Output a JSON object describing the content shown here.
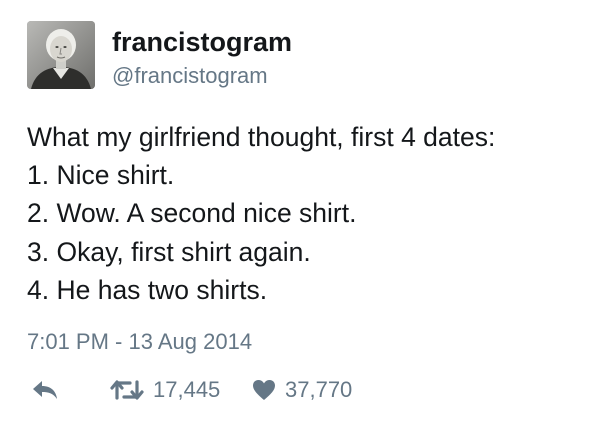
{
  "tweet": {
    "display_name": "francistogram",
    "handle": "@francistogram",
    "lines": [
      "What my girlfriend thought, first 4 dates:",
      "1. Nice shirt.",
      "2. Wow. A second nice shirt.",
      "3. Okay, first shirt again.",
      "4. He has two shirts."
    ],
    "timestamp": "7:01 PM - 13 Aug 2014"
  },
  "actions": {
    "reply_icon": "reply-arrow-icon",
    "retweet_icon": "retweet-icon",
    "retweet_count": "17,445",
    "like_icon": "heart-icon",
    "like_count": "37,770"
  },
  "colors": {
    "text": "#14171a",
    "muted": "#657786",
    "background": "#ffffff"
  }
}
